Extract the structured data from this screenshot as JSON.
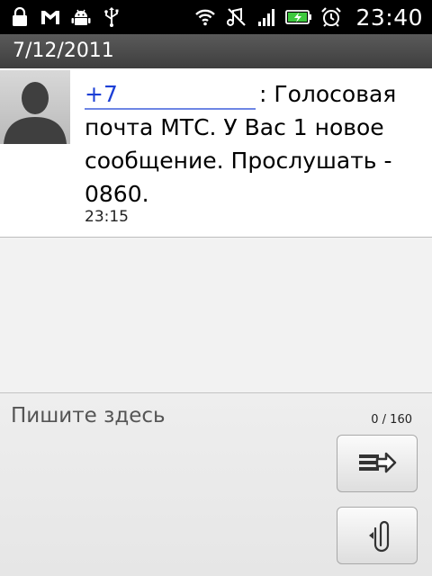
{
  "status_bar": {
    "time": "23:40",
    "left_icons": [
      "lock-icon",
      "gmail-icon",
      "android-debug-icon",
      "usb-icon"
    ],
    "right_icons": [
      "wifi-icon",
      "no-sound-icon",
      "signal-icon",
      "battery-charging-icon",
      "alarm-icon"
    ]
  },
  "date_header": {
    "date": "7/12/2011"
  },
  "message": {
    "sender": "+7",
    "body": ": Голосовая почта МТС. У Вас 1 новое сообщение. Прослушать - 0860.",
    "time": "23:15",
    "avatar_icon": "contact-silhouette-icon"
  },
  "compose": {
    "placeholder": "Пишите здесь",
    "counter": "0 / 160",
    "send_icon": "send-message-icon",
    "attach_icon": "paperclip-icon"
  },
  "colors": {
    "status_bar_bg": "#000000",
    "date_header_bg": "#4a4a4a",
    "sender_link": "#1c3fd6",
    "battery_green": "#3ec93e"
  }
}
